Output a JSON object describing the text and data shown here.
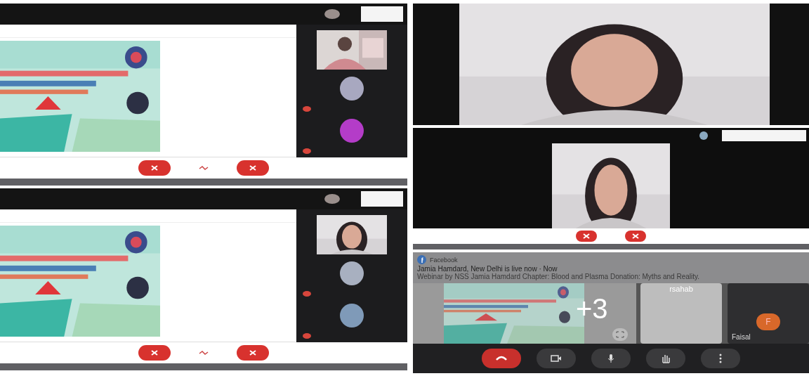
{
  "panels": [
    {
      "kind": "meeting",
      "avatars": [
        {
          "color": "#a8a8c0"
        },
        {
          "color": "#b43cc8"
        }
      ]
    },
    {
      "kind": "meeting",
      "avatars": [
        {
          "color": "#a8b0c0"
        },
        {
          "color": "#7f9ab8"
        }
      ]
    },
    {
      "kind": "camera"
    },
    {
      "kind": "camera_window"
    },
    {
      "kind": "mobile",
      "notification": {
        "app": "Facebook",
        "title": "Jamia Hamdard, New Delhi is live now · Now",
        "body": "Webinar by NSS Jamia Hamdard Chapter: Blood and Plasma Donation: Myths and Reality."
      },
      "overflow_count": "+3",
      "tiles": [
        {
          "name": "rsahab"
        },
        {
          "initial": "F",
          "name": "Faisal"
        }
      ]
    }
  ]
}
